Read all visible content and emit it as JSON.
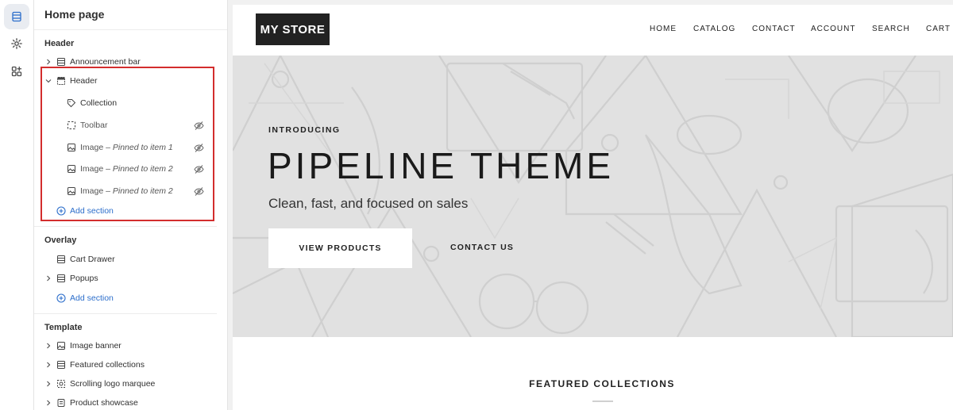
{
  "editor": {
    "page_title": "Home page",
    "groups": {
      "header": {
        "title": "Header",
        "items": [
          {
            "label": "Announcement bar",
            "icon": "layout-section-icon"
          },
          {
            "label": "Header",
            "icon": "layout-header-icon"
          }
        ],
        "children": [
          {
            "label": "Collection",
            "icon": "tag-icon",
            "hidden_icon": false
          },
          {
            "label": "Toolbar",
            "icon": "dashed-frame-icon",
            "hidden_icon": true
          },
          {
            "label_prefix": "Image – ",
            "label_em": "Pinned to item 1",
            "icon": "image-icon",
            "hidden_icon": true
          },
          {
            "label_prefix": "Image – ",
            "label_em": "Pinned to item 2",
            "icon": "image-icon",
            "hidden_icon": true
          },
          {
            "label_prefix": "Image – ",
            "label_em": "Pinned to item 2",
            "icon": "image-icon",
            "hidden_icon": true
          }
        ],
        "add_label": "Add section"
      },
      "overlay": {
        "title": "Overlay",
        "items": [
          {
            "label": "Cart Drawer",
            "icon": "layout-section-icon"
          },
          {
            "label": "Popups",
            "icon": "layout-section-icon"
          }
        ],
        "add_label": "Add section"
      },
      "template": {
        "title": "Template",
        "items": [
          {
            "label": "Image banner",
            "icon": "image-icon"
          },
          {
            "label": "Featured collections",
            "icon": "layout-section-icon"
          },
          {
            "label": "Scrolling logo marquee",
            "icon": "marquee-icon"
          },
          {
            "label": "Product showcase",
            "icon": "product-icon"
          }
        ]
      }
    }
  },
  "store": {
    "logo": "MY STORE",
    "nav": [
      "HOME",
      "CATALOG",
      "CONTACT",
      "ACCOUNT",
      "SEARCH",
      "CART"
    ],
    "hero": {
      "intro": "INTRODUCING",
      "title": "PIPELINE THEME",
      "subtitle": "Clean, fast, and focused on sales",
      "primary_button": "VIEW PRODUCTS",
      "secondary_button": "CONTACT US"
    },
    "featured_title": "FEATURED COLLECTIONS"
  },
  "colors": {
    "accent_link": "#2c6ecb",
    "highlight_border": "#d32d2d",
    "logo_bg": "#222222",
    "hero_bg": "#e1e1e1"
  }
}
